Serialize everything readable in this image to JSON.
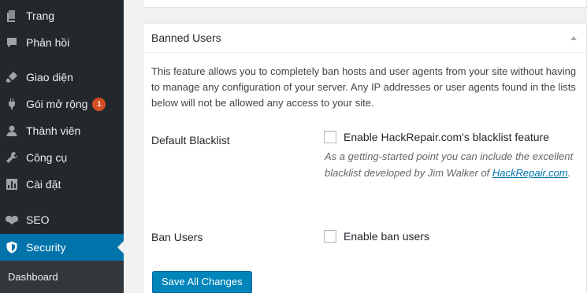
{
  "sidebar": {
    "items": [
      {
        "label": "Trang",
        "icon": "pages-icon"
      },
      {
        "label": "Phản hồi",
        "icon": "comments-icon"
      },
      {
        "label": "Giao diện",
        "icon": "appearance-icon"
      },
      {
        "label": "Gói mở rộng",
        "icon": "plugins-icon",
        "badge": "1"
      },
      {
        "label": "Thành viên",
        "icon": "users-icon"
      },
      {
        "label": "Công cụ",
        "icon": "tools-icon"
      },
      {
        "label": "Cài đặt",
        "icon": "settings-icon"
      },
      {
        "label": "SEO",
        "icon": "seo-icon"
      },
      {
        "label": "Security",
        "icon": "shield-icon",
        "active": true
      }
    ],
    "submenu": {
      "item": "Dashboard"
    }
  },
  "panel": {
    "title": "Banned Users",
    "description": "This feature allows you to completely ban hosts and user agents from your site without having to manage any configuration of your server. Any IP addresses or user agents found in the lists below will not be allowed any access to your site.",
    "default_blacklist": {
      "label": "Default Blacklist",
      "checkbox_label": "Enable HackRepair.com's blacklist feature",
      "checked": false,
      "hint_text": "As a getting-started point you can include the excellent blacklist developed by Jim Walker of ",
      "hint_link": "HackRepair.com",
      "hint_end": "."
    },
    "ban_users": {
      "label": "Ban Users",
      "checkbox_label": "Enable ban users",
      "checked": false
    },
    "save_button": "Save All Changes"
  },
  "colors": {
    "sidebar_bg": "#23282d",
    "active_bg": "#0073aa",
    "badge_bg": "#d54e21",
    "button_bg": "#0085ba",
    "link": "#0073aa"
  }
}
